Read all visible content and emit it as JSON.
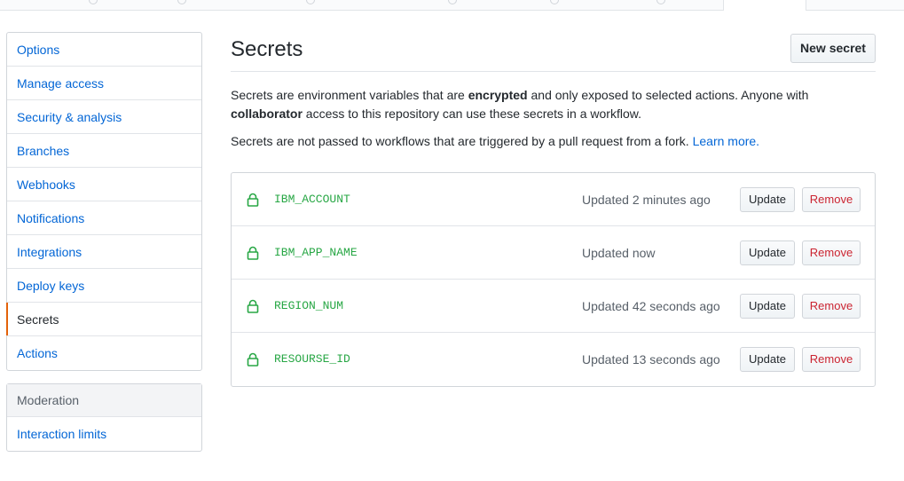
{
  "sidebar": {
    "items": [
      {
        "label": "Options"
      },
      {
        "label": "Manage access"
      },
      {
        "label": "Security & analysis"
      },
      {
        "label": "Branches"
      },
      {
        "label": "Webhooks"
      },
      {
        "label": "Notifications"
      },
      {
        "label": "Integrations"
      },
      {
        "label": "Deploy keys"
      },
      {
        "label": "Secrets",
        "selected": true
      },
      {
        "label": "Actions"
      }
    ],
    "moderation": {
      "heading": "Moderation",
      "items": [
        {
          "label": "Interaction limits"
        }
      ]
    }
  },
  "main": {
    "title": "Secrets",
    "new_button": "New secret",
    "intro_1": "Secrets are environment variables that are ",
    "intro_bold_1": "encrypted",
    "intro_2": " and only exposed to selected actions. Anyone with ",
    "intro_bold_2": "collaborator",
    "intro_3": " access to this repository can use these secrets in a workflow.",
    "fork_note": "Secrets are not passed to workflows that are triggered by a pull request from a fork. ",
    "learn_more": "Learn more."
  },
  "secrets": [
    {
      "name": "IBM_ACCOUNT",
      "updated": "Updated 2 minutes ago",
      "update_label": "Update",
      "remove_label": "Remove"
    },
    {
      "name": "IBM_APP_NAME",
      "updated": "Updated now",
      "update_label": "Update",
      "remove_label": "Remove"
    },
    {
      "name": "REGION_NUM",
      "updated": "Updated 42 seconds ago",
      "update_label": "Update",
      "remove_label": "Remove"
    },
    {
      "name": "RESOURSE_ID",
      "updated": "Updated 13 seconds ago",
      "update_label": "Update",
      "remove_label": "Remove"
    }
  ],
  "icons": {
    "secret": "lock-icon"
  },
  "colors": {
    "link": "#0366d6",
    "secret_name": "#28a745",
    "remove": "#cb2431",
    "selected_marker": "#e36209"
  }
}
